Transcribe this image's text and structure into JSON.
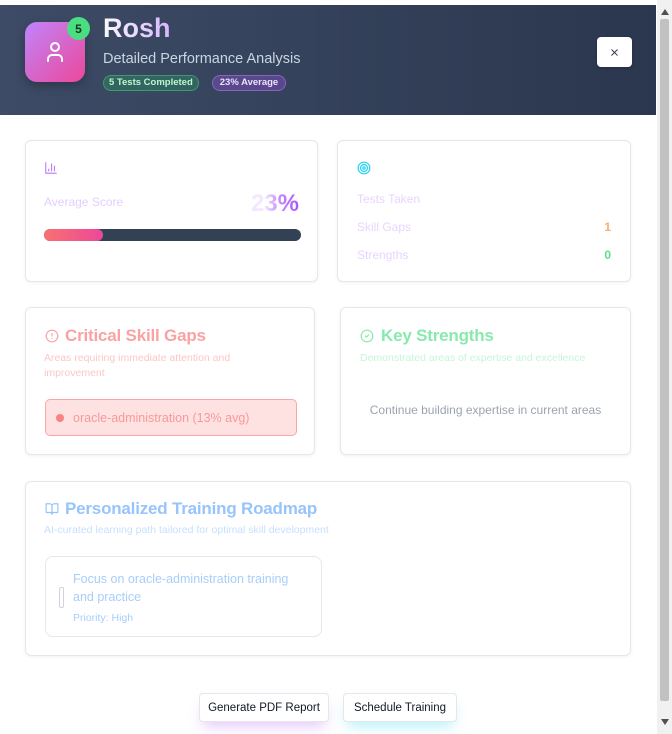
{
  "colors": {
    "header_start": "#3d4b66",
    "header_end": "#2b374e",
    "avatar_start": "#c084fc",
    "avatar_end": "#ec4899",
    "count_badge": "#4ade80",
    "progress_track": "#334155",
    "progress_fill_start": "#f87171",
    "progress_fill_end": "#ec4899",
    "skill_gap": "#f87171",
    "strength": "#4ade80",
    "roadmap": "#60a5fa",
    "stats": "#22d3ee",
    "average": "#c084fc",
    "warning": "#fb923c"
  },
  "header": {
    "avatar_icon": "user-icon",
    "test_count": "5",
    "name": "Rosh",
    "subtitle": "Detailed Performance Analysis",
    "tests_badge": "5 Tests Completed",
    "average_badge": "23% Average",
    "close_icon": "close-icon"
  },
  "average_card": {
    "icon": "bar-chart-icon",
    "label": "Average Score",
    "value": "23%",
    "progress": 0.23
  },
  "stats_card": {
    "icon": "target-icon",
    "rows": [
      {
        "label": "Tests Taken"
      },
      {
        "label": "Skill Gaps",
        "value": "1"
      },
      {
        "label": "Strengths",
        "value": "0"
      }
    ]
  },
  "skill_gaps": {
    "icon": "alert-circle-icon",
    "title": "Critical Skill Gaps",
    "subtitle": "Areas requiring immediate attention and improvement",
    "items": [
      {
        "label": "oracle-administration (13% avg)"
      }
    ]
  },
  "strengths": {
    "icon": "check-circle-icon",
    "title": "Key Strengths",
    "subtitle": "Demonstrated areas of expertise and excellence",
    "empty_message": "Continue building expertise in current areas"
  },
  "roadmap": {
    "icon": "book-open-icon",
    "title": "Personalized Training Roadmap",
    "subtitle": "AI-curated learning path tailored for optimal skill development",
    "items": [
      {
        "title": "Focus on oracle-administration training and practice",
        "priority": "Priority: High"
      }
    ]
  },
  "footer": {
    "report_button": "Generate PDF Report",
    "schedule_button": "Schedule Training"
  },
  "scrollbar": {
    "up_icon": "triangle-up-icon",
    "down_icon": "triangle-down-icon"
  }
}
